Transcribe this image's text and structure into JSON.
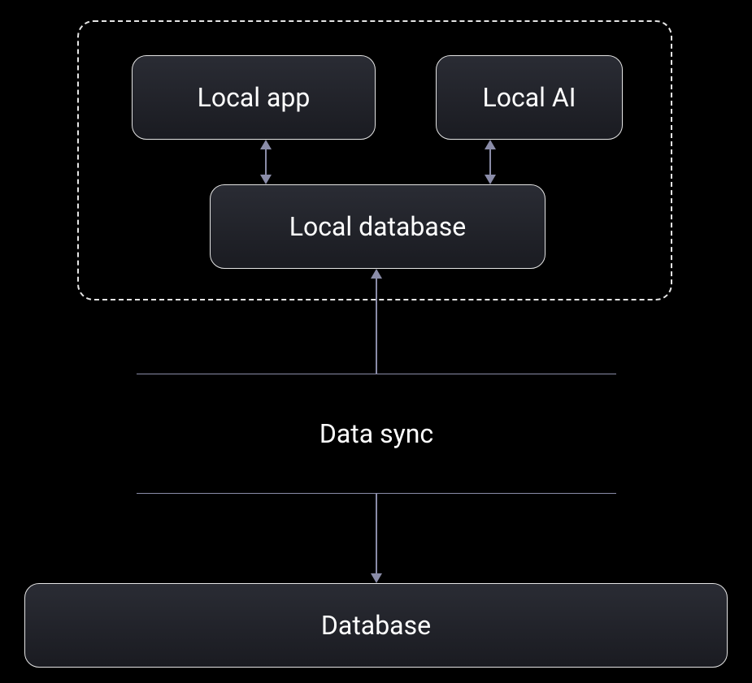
{
  "boxes": {
    "local_app": "Local app",
    "local_ai": "Local AI",
    "local_database": "Local database",
    "database": "Database"
  },
  "sync": {
    "label": "Data sync"
  },
  "colors": {
    "background": "#000000",
    "box_gradient_top": "#2a2c34",
    "box_gradient_bottom": "#1a1b21",
    "border": "#e5e5e5",
    "arrow": "#8a8ca8",
    "text": "#ffffff"
  }
}
